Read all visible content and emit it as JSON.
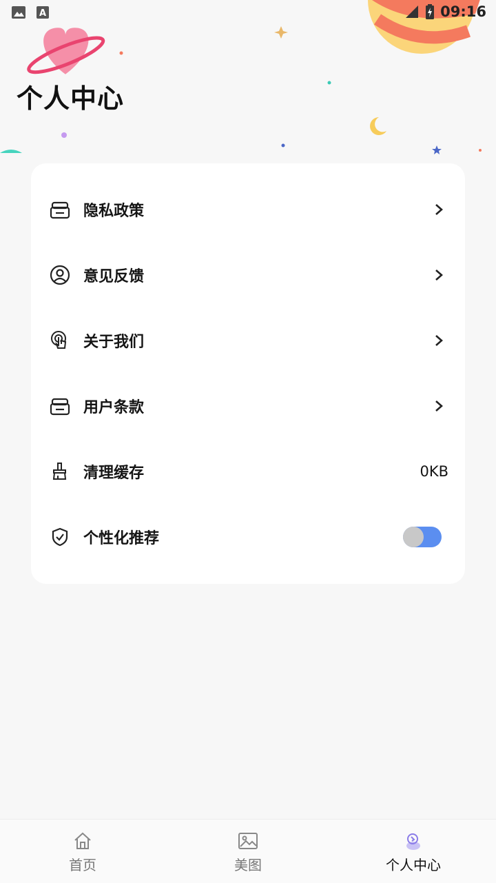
{
  "status_bar": {
    "time": "09:16"
  },
  "header": {
    "title": "个人中心"
  },
  "menu": {
    "items": [
      {
        "label": "隐私政策",
        "icon": "document-stack-icon"
      },
      {
        "label": "意见反馈",
        "icon": "user-circle-icon"
      },
      {
        "label": "关于我们",
        "icon": "touch-hand-icon"
      },
      {
        "label": "用户条款",
        "icon": "document-stack-icon"
      },
      {
        "label": "清理缓存",
        "icon": "broom-icon",
        "value": "0KB"
      },
      {
        "label": "个性化推荐",
        "icon": "shield-check-icon",
        "toggle": "on"
      }
    ]
  },
  "bottom_nav": {
    "items": [
      {
        "label": "首页",
        "icon": "home-icon"
      },
      {
        "label": "美图",
        "icon": "image-icon"
      },
      {
        "label": "个人中心",
        "icon": "profile-icon",
        "active": true
      }
    ]
  },
  "colors": {
    "accent": "#5b8ef0",
    "background": "#f7f7f7",
    "card": "#ffffff"
  }
}
